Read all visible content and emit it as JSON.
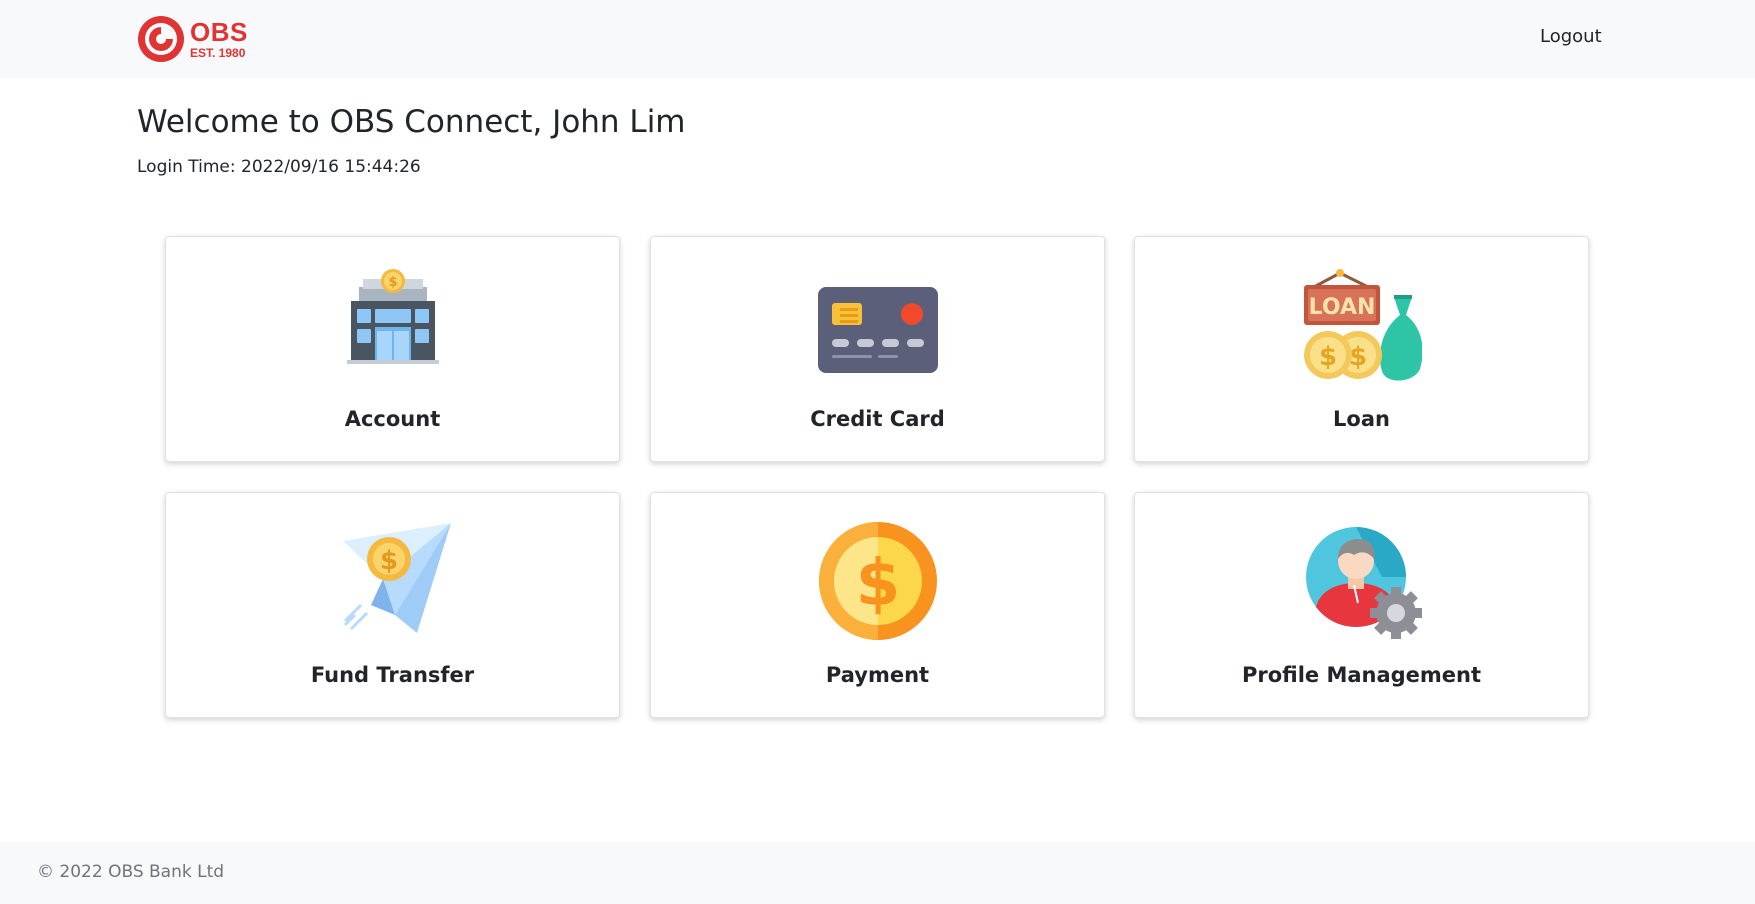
{
  "header": {
    "brand": "OBS",
    "established": "EST. 1980",
    "logout_label": "Logout"
  },
  "main": {
    "welcome": "Welcome to OBS Connect, John Lim",
    "login_time": "Login Time: 2022/09/16 15:44:26",
    "tiles": [
      {
        "label": "Account",
        "icon": "bank-building-icon"
      },
      {
        "label": "Credit Card",
        "icon": "credit-card-icon"
      },
      {
        "label": "Loan",
        "icon": "loan-sign-money-bag-icon"
      },
      {
        "label": "Fund Transfer",
        "icon": "paper-plane-coin-icon"
      },
      {
        "label": "Payment",
        "icon": "dollar-coin-icon"
      },
      {
        "label": "Profile Management",
        "icon": "user-gear-icon"
      }
    ]
  },
  "footer": {
    "copyright": "© 2022 OBS Bank Ltd"
  },
  "colors": {
    "brand_red": "#e03434",
    "header_bg": "#f8f9fa",
    "text": "#212529",
    "muted": "#6c757d"
  }
}
